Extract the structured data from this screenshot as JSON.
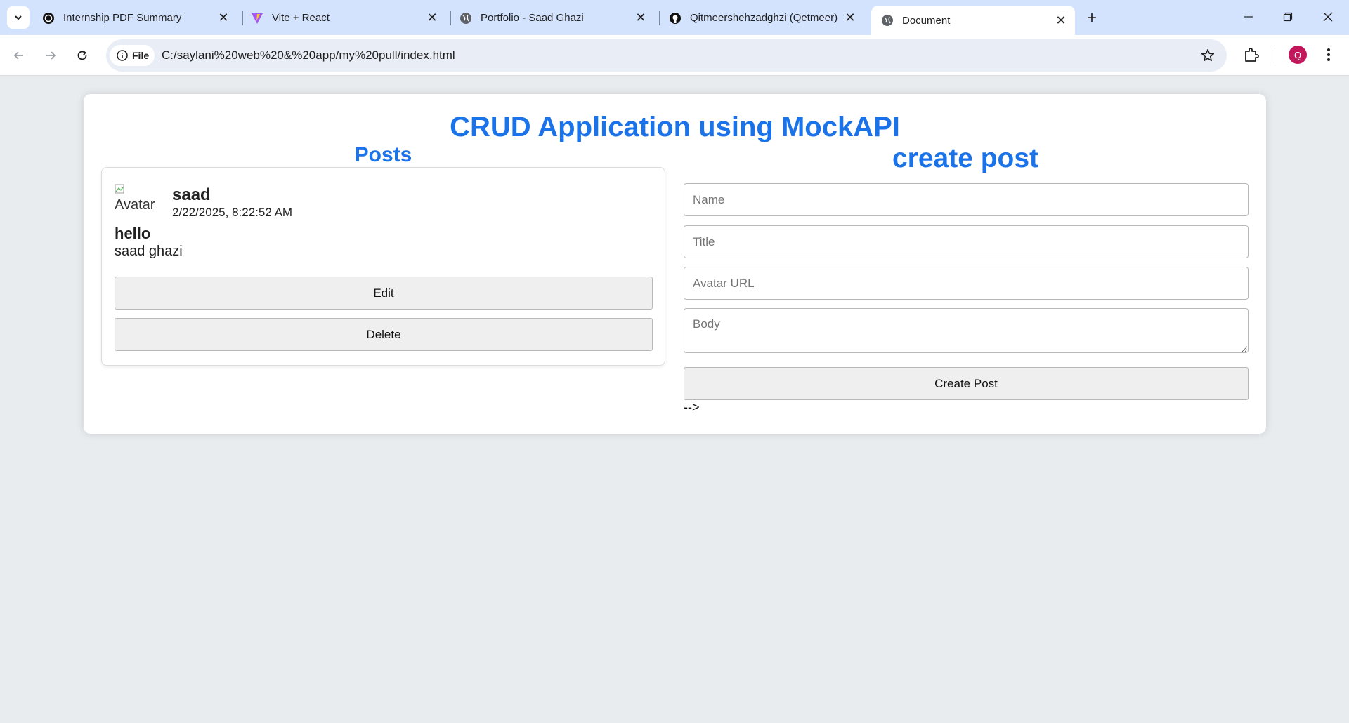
{
  "browser": {
    "tabs": [
      {
        "title": "Internship PDF Summary",
        "icon": "openai-icon"
      },
      {
        "title": "Vite + React",
        "icon": "vite-icon"
      },
      {
        "title": "Portfolio - Saad Ghazi",
        "icon": "globe-icon"
      },
      {
        "title": "Qitmeershehzadghzi (Qetmeer)",
        "icon": "github-icon"
      },
      {
        "title": "Document",
        "icon": "globe-icon",
        "active": true
      }
    ],
    "site_chip": "File",
    "url": "C:/saylani%20web%20&%20app/my%20pull/index.html",
    "profile_initial": "Q",
    "profile_color": "#c2185b"
  },
  "page": {
    "title": "CRUD Application using MockAPI",
    "accent_color": "#1a73e8"
  },
  "posts": {
    "heading": "Posts",
    "items": [
      {
        "avatar_alt": "Avatar",
        "author": "saad",
        "date": "2/22/2025, 8:22:52 AM",
        "title": "hello",
        "body": "saad ghazi",
        "edit_label": "Edit",
        "delete_label": "Delete"
      }
    ]
  },
  "create": {
    "heading": "create post",
    "name_placeholder": "Name",
    "title_placeholder": "Title",
    "avatar_placeholder": "Avatar URL",
    "body_placeholder": "Body",
    "submit_label": "Create Post",
    "stray_text": "-->"
  }
}
